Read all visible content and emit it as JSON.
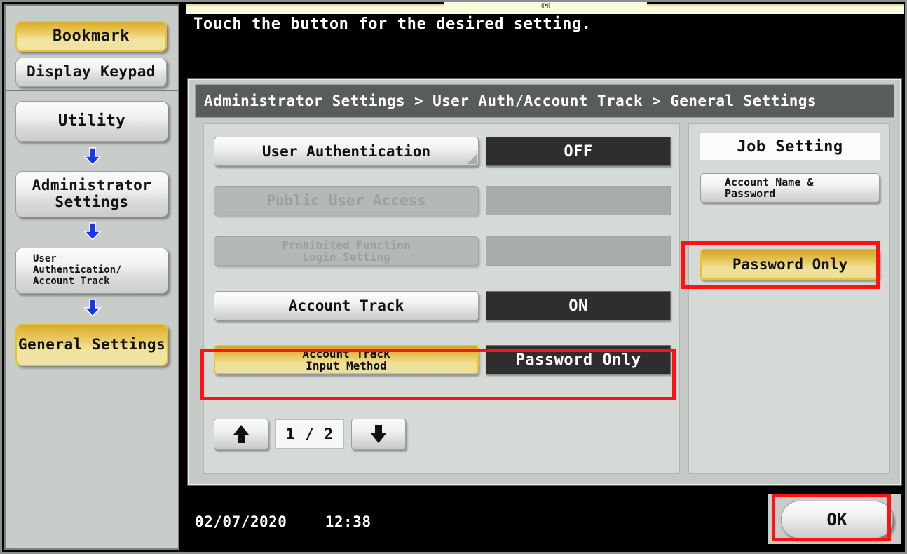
{
  "prompt": "Touch the button for the desired setting.",
  "breadcrumb": "Administrator Settings > User Auth/Account Track  > General Settings",
  "sidebar": {
    "top_items": [
      {
        "label": "Bookmark",
        "state": "selected"
      },
      {
        "label": "Display Keypad",
        "state": "normal"
      }
    ],
    "path_items": [
      {
        "label": "Utility",
        "state": "normal"
      },
      {
        "label": "Administrator\nSettings",
        "state": "normal"
      },
      {
        "label": "User\nAuthentication/\nAccount Track",
        "state": "normal"
      },
      {
        "label": "General Settings",
        "state": "selected"
      }
    ],
    "arrow_icon": "arrow-down-icon"
  },
  "settings_rows": [
    {
      "label": "User Authentication",
      "value": "OFF",
      "state": "enabled",
      "has_corner_marker": true,
      "highlighted": false
    },
    {
      "label": "Public User Access",
      "value": "",
      "state": "disabled",
      "has_corner_marker": false,
      "highlighted": false
    },
    {
      "label": "Prohibited Function\nLogin Setting",
      "value": "",
      "state": "disabled",
      "has_corner_marker": false,
      "highlighted": false
    },
    {
      "label": "Account Track",
      "value": "ON",
      "state": "enabled",
      "has_corner_marker": false,
      "highlighted": false
    },
    {
      "label": "Account Track\nInput Method",
      "value": "Password Only",
      "state": "selected",
      "has_corner_marker": false,
      "highlighted": true
    }
  ],
  "pager": {
    "up_icon": "arrow-up-icon",
    "down_icon": "arrow-down-icon",
    "count": "1 / 2"
  },
  "right_pane": {
    "title": "Job Setting",
    "buttons": [
      {
        "label": "Account Name &\nPassword",
        "state": "normal",
        "highlighted": false
      },
      {
        "label": "Password Only",
        "state": "selected",
        "highlighted": true
      }
    ]
  },
  "status_bar": {
    "date": "02/07/2020",
    "time": "12:38",
    "ok_label": "OK"
  },
  "colors": {
    "accent_gold": "#ecc326",
    "highlight_red": "#ff1212",
    "panel_gray": "#c5cac6",
    "value_dark": "#2e2e2e",
    "breadcrumb_gray": "#595d5a",
    "arrow_blue": "#1637f0"
  },
  "top_indicator": "((•))"
}
